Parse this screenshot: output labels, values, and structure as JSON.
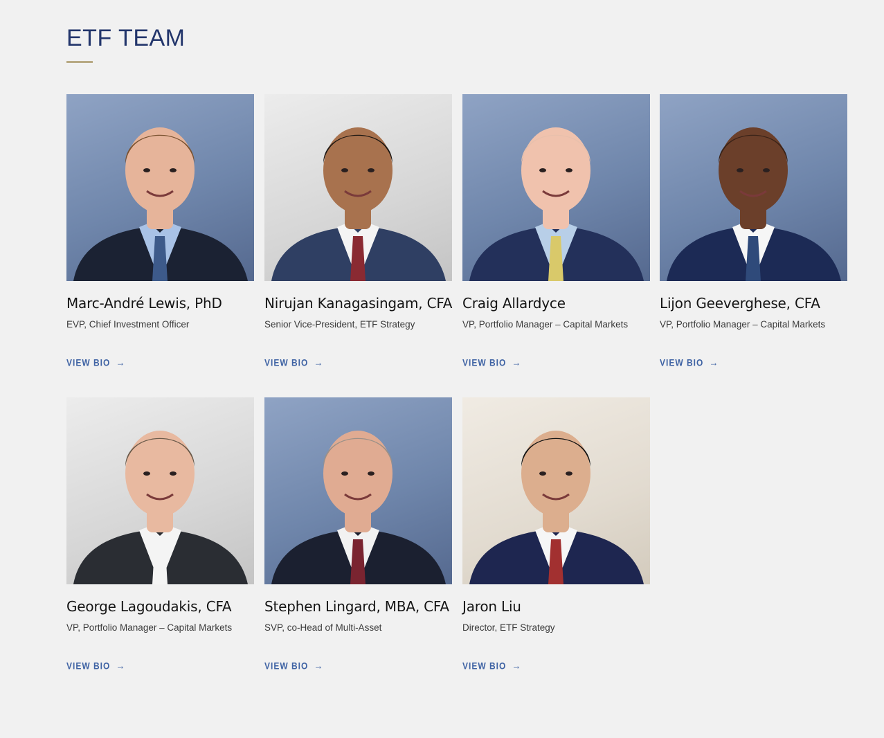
{
  "section": {
    "title": "ETF TEAM"
  },
  "members": [
    {
      "name": "Marc-André Lewis, PhD",
      "role": "EVP, Chief Investment Officer",
      "link_label": "VIEW BIO",
      "photo_bg": "blue",
      "skin": "#e6b49a",
      "hair": "#7a5230",
      "tie": "#3d5a8a",
      "shirt": "#a9c2e6",
      "suit": "#1b2233"
    },
    {
      "name": "Nirujan Kanagasingam, CFA",
      "role": "Senior Vice-President, ETF Strategy",
      "link_label": "VIEW BIO",
      "photo_bg": "grey",
      "skin": "#a8724e",
      "hair": "#1c1612",
      "tie": "#8a2a32",
      "shirt": "#f4f4f4",
      "suit": "#2f3f63"
    },
    {
      "name": "Craig Allardyce",
      "role": "VP, Portfolio Manager – Capital Markets",
      "link_label": "VIEW BIO",
      "photo_bg": "blue",
      "skin": "#f0c2ad",
      "hair": "#e8c0ac",
      "tie": "#d9c96a",
      "shirt": "#b8cfe8",
      "suit": "#23305a"
    },
    {
      "name": "Lijon Geeverghese, CFA",
      "role": "VP, Portfolio Manager – Capital Markets",
      "link_label": "VIEW BIO",
      "photo_bg": "blue",
      "skin": "#6b3f2a",
      "hair": "#3a2318",
      "tie": "#2f4a7a",
      "shirt": "#f6f6f6",
      "suit": "#1c2a55"
    },
    {
      "name": "George Lagoudakis, CFA",
      "role": "VP, Portfolio Manager – Capital Markets",
      "link_label": "VIEW BIO",
      "photo_bg": "grey",
      "skin": "#e8b9a0",
      "hair": "#6a5a4a",
      "tie": "#f4f4f4",
      "shirt": "#f4f4f4",
      "suit": "#2a2d33"
    },
    {
      "name": "Stephen Lingard, MBA, CFA",
      "role": "SVP, co-Head of Multi-Asset",
      "link_label": "VIEW BIO",
      "photo_bg": "blue",
      "skin": "#e0ab92",
      "hair": "#9a9088",
      "tie": "#7a2430",
      "shirt": "#f2f2f2",
      "suit": "#1b2030"
    },
    {
      "name": "Jaron Liu",
      "role": "Director, ETF Strategy",
      "link_label": "VIEW BIO",
      "photo_bg": "beige",
      "skin": "#dcae8e",
      "hair": "#141414",
      "tie": "#a23030",
      "shirt": "#f6f6f6",
      "suit": "#1e2650"
    }
  ],
  "colors": {
    "heading": "#22356b",
    "accent_rule": "#b8aa84",
    "link": "#3f63a4",
    "background": "#f1f1f1"
  },
  "icons": {
    "link_arrow": "arrow-right-icon"
  }
}
